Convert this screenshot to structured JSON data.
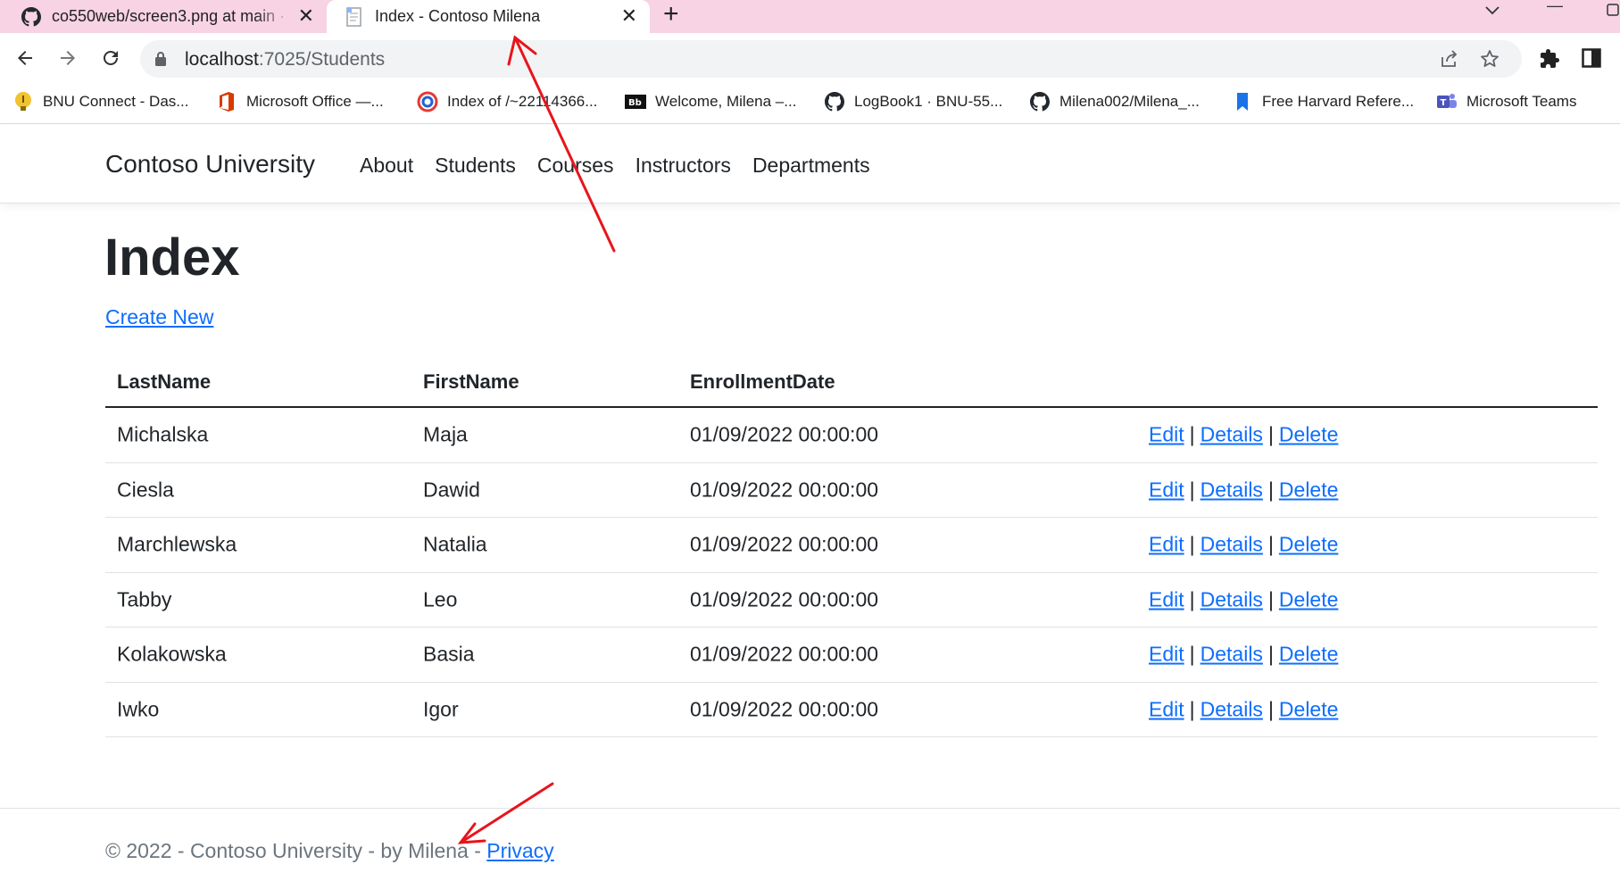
{
  "browser": {
    "tabs": [
      {
        "title": "co550web/screen3.png at main ·",
        "icon": "github-icon",
        "active": false
      },
      {
        "title": "Index - Contoso Milena",
        "icon": "page-icon",
        "active": true
      }
    ],
    "url_host": "localhost",
    "url_path": ":7025/Students",
    "bookmarks": [
      {
        "label": "BNU Connect - Das...",
        "icon": "bulb-icon"
      },
      {
        "label": "Microsoft Office —...",
        "icon": "office-icon"
      },
      {
        "label": "Index of /~22114366...",
        "icon": "globe-icon"
      },
      {
        "label": "Welcome, Milena –...",
        "icon": "blackboard-icon"
      },
      {
        "label": "LogBook1 · BNU-55...",
        "icon": "github-icon"
      },
      {
        "label": "Milena002/Milena_...",
        "icon": "github-icon"
      },
      {
        "label": "Free Harvard Refere...",
        "icon": "bookmark-icon"
      },
      {
        "label": "Microsoft Teams",
        "icon": "teams-icon"
      }
    ]
  },
  "site": {
    "brand": "Contoso University",
    "nav": [
      "About",
      "Students",
      "Courses",
      "Instructors",
      "Departments"
    ]
  },
  "page": {
    "heading": "Index",
    "create_link": "Create New"
  },
  "table": {
    "columns": [
      "LastName",
      "FirstName",
      "EnrollmentDate"
    ],
    "actions": {
      "edit": "Edit",
      "details": "Details",
      "delete": "Delete",
      "separator": "|"
    },
    "rows": [
      {
        "last": "Michalska",
        "first": "Maja",
        "date": "01/09/2022 00:00:00"
      },
      {
        "last": "Ciesla",
        "first": "Dawid",
        "date": "01/09/2022 00:00:00"
      },
      {
        "last": "Marchlewska",
        "first": "Natalia",
        "date": "01/09/2022 00:00:00"
      },
      {
        "last": "Tabby",
        "first": "Leo",
        "date": "01/09/2022 00:00:00"
      },
      {
        "last": "Kolakowska",
        "first": "Basia",
        "date": "01/09/2022 00:00:00"
      },
      {
        "last": "Iwko",
        "first": "Igor",
        "date": "01/09/2022 00:00:00"
      }
    ]
  },
  "footer": {
    "text": "© 2022 - Contoso University - by Milena - ",
    "privacy": "Privacy"
  },
  "colors": {
    "tabstrip": "#f7d3e3",
    "link": "#0d6efd",
    "annotation_arrow": "#e8141b"
  }
}
